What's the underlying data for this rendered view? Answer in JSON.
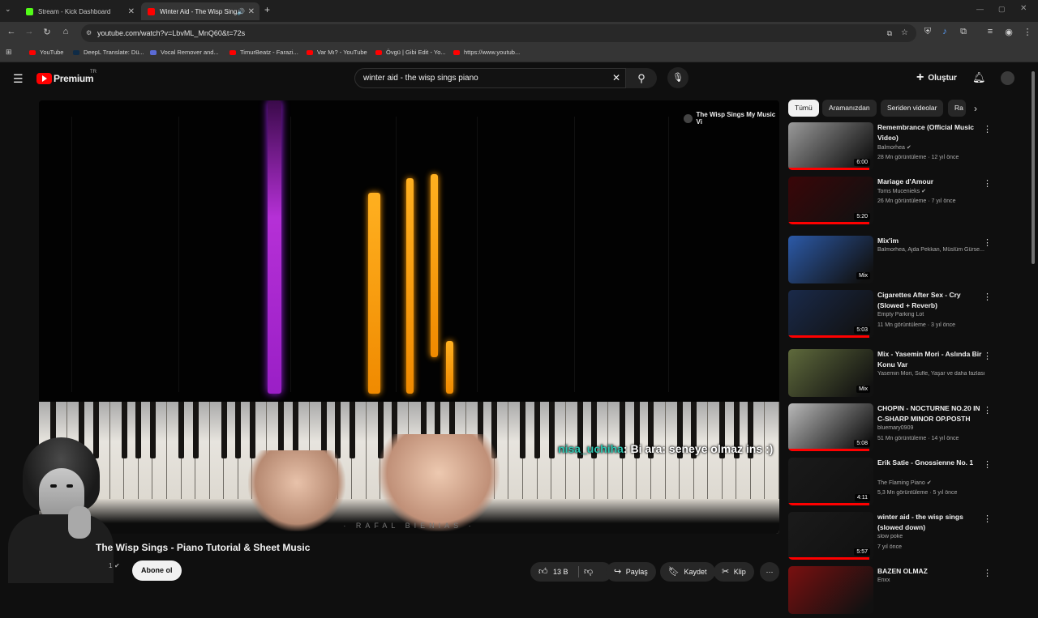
{
  "browser": {
    "tabs": [
      {
        "title": "Stream - Kick Dashboard",
        "favicon_color": "#53fc18"
      },
      {
        "title": "Winter Aid - The Wisp Sings",
        "favicon_color": "#ff0000"
      }
    ],
    "url": "youtube.com/watch?v=LbvML_MnQ60&t=72s",
    "bookmarks": [
      "YouTube",
      "DeepL Translate: Dü...",
      "Vocal Remover and...",
      "TimurBeatz - Farazi...",
      "Var Mı? - YouTube",
      "Övgü | Gibi Edit - Yo...",
      "https://www.youtub..."
    ]
  },
  "header": {
    "logo": "Premium",
    "region": "TR",
    "search_query": "winter aid - the wisp sings piano",
    "create_label": "Oluştur"
  },
  "player": {
    "channel_watermark": "The Wisp Sings My Music Vi",
    "keyboard_brand": "· RAFAL  BIENIAS ·",
    "chat_user": "nisa_uchiha",
    "chat_message": ": Bi ara: seneye olmaz ins :)"
  },
  "video": {
    "title": "The Wisp Sings - Piano Tutorial & Sheet Music",
    "subscribe_label": "Abone ol",
    "subscriber_fragment": "1",
    "likes": "13 B",
    "share_label": "Paylaş",
    "save_label": "Kaydet",
    "clip_label": "Klip"
  },
  "filters": [
    "Tümü",
    "Aramanızdan",
    "Seriden videolar",
    "Ra"
  ],
  "recommendations": [
    {
      "title": "Remembrance (Official Music Video)",
      "channel": "Balmorhea",
      "verified": true,
      "meta": "28 Mn görüntüleme · 12 yıl önce",
      "duration": "6:00",
      "thumb_color": "#9a9a9a",
      "progress": 0.95
    },
    {
      "title": "Mariage d'Amour",
      "channel": "Toms Mucenieks",
      "verified": true,
      "meta": "26 Mn görüntüleme · 7 yıl önce",
      "duration": "5:20",
      "thumb_color": "#3a0608",
      "progress": 0.95
    },
    {
      "title": "Mix'im",
      "channel": "Balmorhea, Ajda Pekkan, Müslüm Gürse...",
      "verified": false,
      "meta": "",
      "duration": "Mix",
      "thumb_color": "#2c5aa8",
      "progress": 0
    },
    {
      "title": "Cigarettes After Sex - Cry (Slowed + Reverb)",
      "channel": "Empty Parking Lot",
      "verified": false,
      "meta": "11 Mn görüntüleme · 3 yıl önce",
      "duration": "5:03",
      "thumb_color": "#1a2a4a",
      "progress": 0.95
    },
    {
      "title": "Mix - Yasemin Mori - Aslında Bir Konu Var",
      "channel": "Yasemin Mori, Sufle, Yaşar ve daha fazlası",
      "verified": false,
      "meta": "",
      "duration": "Mix",
      "thumb_color": "#5f6a3c",
      "progress": 0
    },
    {
      "title": "CHOPIN - NOCTURNE NO.20 IN C-SHARP MINOR OP.POSTH",
      "channel": "bluemary0909",
      "verified": false,
      "meta": "51 Mn görüntüleme · 14 yıl önce",
      "duration": "5:08",
      "thumb_color": "#b9b9b9",
      "progress": 0.95
    },
    {
      "title": "Erik Satie - Gnossienne No. 1",
      "channel": "The Flaming Piano",
      "verified": true,
      "meta": "5,3 Mn görüntüleme · 5 yıl önce",
      "duration": "4:11",
      "thumb_color": "#1a1a1a",
      "progress": 0.95
    },
    {
      "title": "winter aid - the wisp sings (slowed down)",
      "channel": "slow poke",
      "verified": false,
      "meta": "7 yıl önce",
      "duration": "5:57",
      "thumb_color": "#1b1b1b",
      "progress": 0.95
    },
    {
      "title": "BAZEN OLMAZ",
      "channel": "Erixx",
      "verified": false,
      "meta": "",
      "duration": "",
      "thumb_color": "#7a1010",
      "progress": 0
    }
  ]
}
